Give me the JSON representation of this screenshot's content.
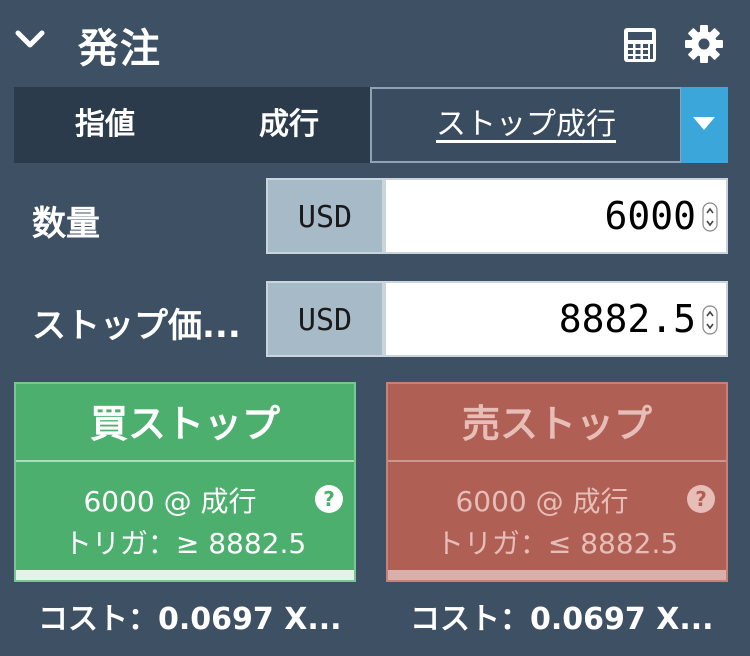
{
  "header": {
    "title": "発注",
    "icons": [
      "chevron-down-icon",
      "calculator-icon",
      "gear-icon"
    ]
  },
  "tabs": {
    "limit": "指値",
    "market": "成行",
    "stop_market": "ストップ成行"
  },
  "fields": {
    "quantity": {
      "label": "数量",
      "currency": "USD",
      "value": "6000"
    },
    "stop_price": {
      "label": "ストップ価...",
      "currency": "USD",
      "value": "8882.5"
    }
  },
  "buy": {
    "title": "買ストップ",
    "line1": "6000 @ 成行",
    "line2": "トリガ：≥ 8882.5",
    "cost": "コスト：0.0697 X..."
  },
  "sell": {
    "title": "売ストップ",
    "line1": "6000 @ 成行",
    "line2": "トリガ：≤ 8882.5",
    "cost": "コスト：0.0697 X..."
  },
  "colors": {
    "panel_bg": "#3e5064",
    "buy": "#4caf6d",
    "sell": "#b05f55",
    "accent": "#3aa6d9"
  }
}
